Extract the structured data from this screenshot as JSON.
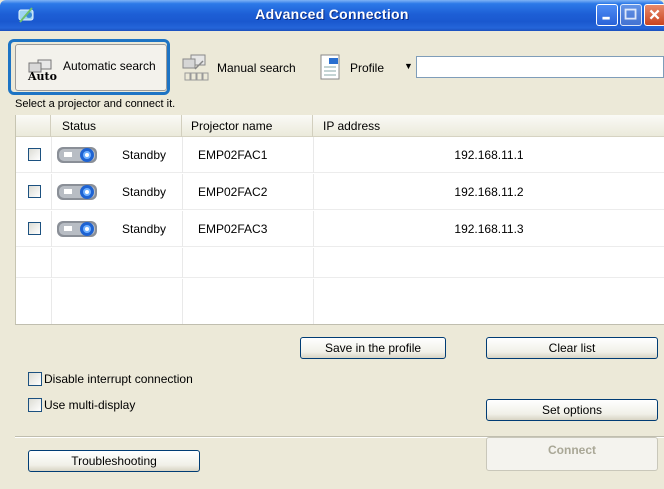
{
  "window": {
    "title": "Advanced Connection"
  },
  "toolbar": {
    "auto_icon_text": "Auto",
    "automatic_search_label": "Automatic search",
    "manual_search_label": "Manual search",
    "profile_label": "Profile",
    "profile_value": ""
  },
  "hint": "Select a projector and connect it.",
  "list": {
    "columns": [
      "Status",
      "Projector name",
      "IP address"
    ],
    "rows": [
      {
        "status": "Standby",
        "name": "EMP02FAC1",
        "ip": "192.168.11.1",
        "checked": false
      },
      {
        "status": "Standby",
        "name": "EMP02FAC2",
        "ip": "192.168.11.2",
        "checked": false
      },
      {
        "status": "Standby",
        "name": "EMP02FAC3",
        "ip": "192.168.11.3",
        "checked": false
      }
    ]
  },
  "buttons": {
    "save_profile": "Save in the profile",
    "clear_list": "Clear list",
    "set_options": "Set options",
    "troubleshooting": "Troubleshooting",
    "connect": "Connect"
  },
  "options": {
    "disable_interrupt": "Disable interrupt connection",
    "use_multi_display": "Use multi-display"
  },
  "colors": {
    "title_bar": "#1d5fd6",
    "highlight": "#1d74c4",
    "window_bg": "#ece9d8"
  }
}
